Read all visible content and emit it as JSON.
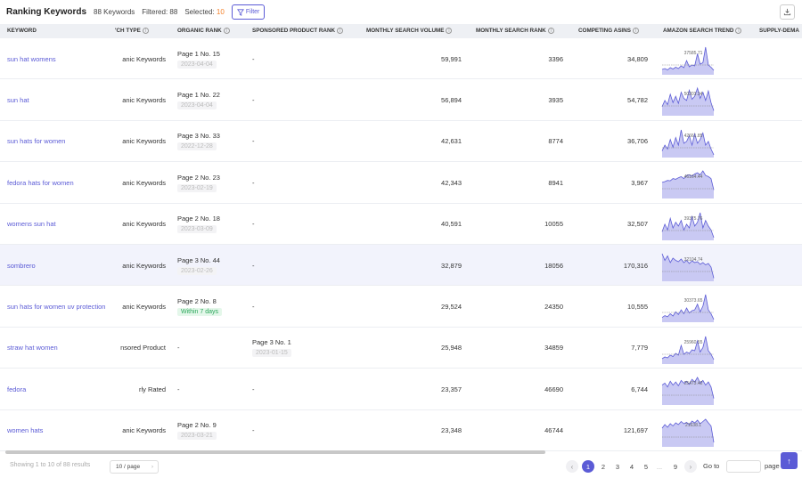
{
  "header": {
    "title": "Ranking Keywords",
    "keywords_count": "88 Keywords",
    "filtered": "Filtered: 88",
    "selected_label": "Selected:",
    "selected_value": "10",
    "filter_label": "Filter"
  },
  "columns": {
    "keyword": "KEYWORD",
    "type": "'CH TYPE",
    "organic": "ORGANIC RANK",
    "sponsored": "SPONSORED PRODUCT RANK",
    "volume": "MONTHLY SEARCH VOLUME",
    "search_rank": "MONTHLY SEARCH RANK",
    "asins": "COMPETING ASINS",
    "trend": "AMAZON SEARCH TREND",
    "supply": "SUPPLY-DEMA"
  },
  "rows": [
    {
      "keyword": "sun hat womens",
      "type": "anic Keywords",
      "organic": "Page 1 No. 15",
      "organic_date": "2023-04-04",
      "organic_badge": "",
      "sponsored": "-",
      "sponsored_date": "",
      "volume": "59,991",
      "search_rank": "3396",
      "asins": "34,809",
      "trend_label": "37585.71",
      "trend": [
        10,
        12,
        9,
        14,
        11,
        15,
        12,
        18,
        14,
        30,
        16,
        20,
        18,
        45,
        22,
        25,
        60,
        20,
        15,
        8
      ]
    },
    {
      "keyword": "sun hat",
      "type": "anic Keywords",
      "organic": "Page 1 No. 22",
      "organic_date": "2023-04-04",
      "organic_badge": "",
      "sponsored": "-",
      "sponsored_date": "",
      "volume": "56,894",
      "search_rank": "3935",
      "asins": "54,782",
      "trend_label": "50303.34",
      "trend": [
        20,
        35,
        25,
        50,
        30,
        45,
        28,
        55,
        40,
        35,
        60,
        38,
        45,
        65,
        40,
        55,
        35,
        58,
        30,
        10
      ]
    },
    {
      "keyword": "sun hats for women",
      "type": "anic Keywords",
      "organic": "Page 3 No. 33",
      "organic_date": "2022-12-28",
      "organic_badge": "",
      "sponsored": "-",
      "sponsored_date": "",
      "volume": "42,631",
      "search_rank": "8774",
      "asins": "36,706",
      "trend_label": "42661.85",
      "trend": [
        15,
        30,
        20,
        45,
        25,
        50,
        30,
        70,
        35,
        40,
        55,
        30,
        60,
        35,
        45,
        62,
        30,
        40,
        20,
        5
      ]
    },
    {
      "keyword": "fedora hats for women",
      "type": "anic Keywords",
      "organic": "Page 2 No. 23",
      "organic_date": "2023-02-19",
      "organic_badge": "",
      "sponsored": "-",
      "sponsored_date": "",
      "volume": "42,343",
      "search_rank": "8941",
      "asins": "3,967",
      "trend_label": "46164.44",
      "trend": [
        40,
        42,
        45,
        44,
        50,
        48,
        52,
        55,
        50,
        58,
        60,
        56,
        62,
        65,
        60,
        70,
        58,
        55,
        50,
        20
      ]
    },
    {
      "keyword": "womens sun hat",
      "type": "anic Keywords",
      "organic": "Page 2 No. 18",
      "organic_date": "2023-03-09",
      "organic_badge": "",
      "sponsored": "-",
      "sponsored_date": "",
      "volume": "40,591",
      "search_rank": "10055",
      "asins": "32,507",
      "trend_label": "39375.76",
      "trend": [
        20,
        40,
        25,
        55,
        30,
        45,
        35,
        50,
        25,
        40,
        30,
        60,
        35,
        45,
        70,
        30,
        50,
        35,
        25,
        5
      ]
    },
    {
      "keyword": "sombrero",
      "type": "anic Keywords",
      "organic": "Page 3 No. 44",
      "organic_date": "2023-02-26",
      "organic_badge": "",
      "sponsored": "-",
      "sponsored_date": "",
      "volume": "32,879",
      "search_rank": "18056",
      "asins": "170,316",
      "trend_label": "32104.74",
      "trend": [
        60,
        45,
        55,
        40,
        50,
        45,
        42,
        48,
        40,
        45,
        38,
        44,
        40,
        42,
        36,
        40,
        35,
        38,
        30,
        5
      ]
    },
    {
      "keyword": "sun hats for women uv protection",
      "type": "anic Keywords",
      "organic": "Page 2 No. 8",
      "organic_date": "",
      "organic_badge": "Within 7 days",
      "sponsored": "-",
      "sponsored_date": "",
      "volume": "29,524",
      "search_rank": "24350",
      "asins": "10,555",
      "trend_label": "30373.65",
      "trend": [
        10,
        15,
        12,
        20,
        14,
        25,
        18,
        30,
        20,
        35,
        22,
        28,
        30,
        45,
        25,
        40,
        70,
        30,
        20,
        5
      ]
    },
    {
      "keyword": "straw hat women",
      "type": "nsored Product",
      "organic": "-",
      "organic_date": "",
      "organic_badge": "",
      "sponsored": "Page 3 No. 1",
      "sponsored_date": "2023-01-15",
      "volume": "25,948",
      "search_rank": "34859",
      "asins": "7,779",
      "trend_label": "25960.55",
      "trend": [
        10,
        14,
        12,
        18,
        15,
        22,
        18,
        40,
        20,
        25,
        22,
        30,
        28,
        50,
        25,
        35,
        60,
        28,
        20,
        8
      ]
    },
    {
      "keyword": "fedora",
      "type": "rly Rated",
      "organic": "-",
      "organic_date": "",
      "organic_badge": "",
      "sponsored": "-",
      "sponsored_date": "",
      "volume": "23,357",
      "search_rank": "46690",
      "asins": "6,744",
      "trend_label": "25473.42",
      "trend": [
        50,
        55,
        45,
        60,
        50,
        58,
        48,
        62,
        55,
        60,
        52,
        65,
        58,
        70,
        55,
        62,
        50,
        58,
        45,
        15
      ]
    },
    {
      "keyword": "women hats",
      "type": "anic Keywords",
      "organic": "Page 2 No. 9",
      "organic_date": "2023-03-21",
      "organic_badge": "",
      "sponsored": "-",
      "sponsored_date": "",
      "volume": "23,348",
      "search_rank": "46744",
      "asins": "121,697",
      "trend_label": "21638.1",
      "trend": [
        40,
        48,
        42,
        50,
        45,
        52,
        48,
        55,
        50,
        53,
        48,
        56,
        52,
        58,
        50,
        55,
        60,
        52,
        45,
        8
      ]
    }
  ],
  "footer": {
    "showing": "Showing 1 to 10 of 88 results",
    "page_size": "10 / page",
    "pages": [
      "1",
      "2",
      "3",
      "4",
      "5",
      "...",
      "9"
    ],
    "current_page": "1",
    "goto_label": "Go to",
    "page_label": "page"
  },
  "colors": {
    "accent": "#5b5bd6",
    "orange": "#f5822a",
    "green": "#2aa75a"
  },
  "icons": {
    "download": "download-icon",
    "filter": "filter-icon",
    "top": "arrow-up-icon",
    "info": "info-icon"
  }
}
